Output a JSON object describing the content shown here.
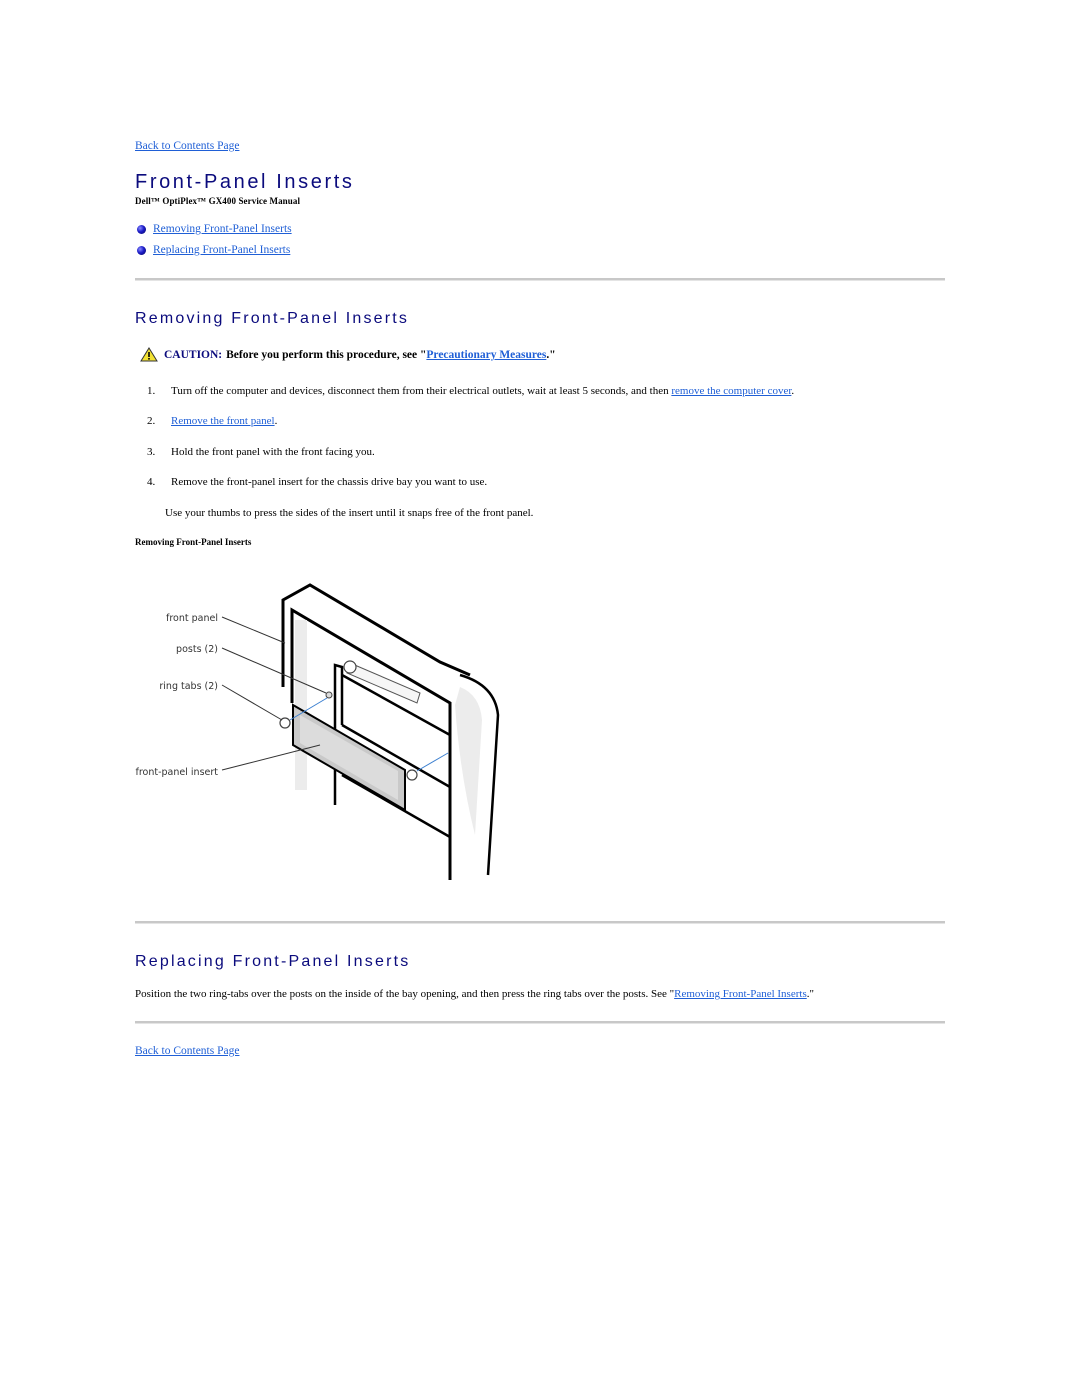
{
  "nav": {
    "back_top": "Back to Contents Page",
    "back_bottom": "Back to Contents Page"
  },
  "header": {
    "title": "Front-Panel Inserts",
    "subtitle": "Dell™ OptiPlex™ GX400 Service Manual"
  },
  "toc": [
    {
      "label": "Removing Front-Panel Inserts",
      "icon": "bullet-icon"
    },
    {
      "label": "Replacing Front-Panel Inserts",
      "icon": "bullet-icon"
    }
  ],
  "removing": {
    "heading": "Removing Front-Panel Inserts",
    "caution": {
      "icon": "warning-triangle-icon",
      "label": "CAUTION:",
      "text_before": "Before you perform this procedure, see \"",
      "link": "Precautionary Measures",
      "text_after": ".\""
    },
    "steps": [
      {
        "num": "1.",
        "text": "Turn off the computer and devices, disconnect them from their electrical outlets, wait at least 5 seconds, and then ",
        "link": "remove the computer cover",
        "after": "."
      },
      {
        "num": "2.",
        "text": "",
        "link": "Remove the front panel",
        "after": "."
      },
      {
        "num": "3.",
        "text": "Hold the front panel with the front facing you.",
        "link": "",
        "after": ""
      },
      {
        "num": "4.",
        "text": "Remove the front-panel insert for the chassis drive bay you want to use.",
        "link": "",
        "after": ""
      }
    ],
    "note": "Use your thumbs to press the sides of the insert until it snaps free of the front panel.",
    "figure_caption": "Removing Front-Panel Inserts",
    "figure_labels": [
      "front panel",
      "posts (2)",
      "ring tabs (2)",
      "front-panel insert"
    ]
  },
  "replacing": {
    "heading": "Replacing Front-Panel Inserts",
    "text": "Position the two ring-tabs over the posts on the inside of the bay opening, and then press the ring tabs over the posts. See \"",
    "link": "Removing Front-Panel Inserts",
    "after": ".\""
  }
}
